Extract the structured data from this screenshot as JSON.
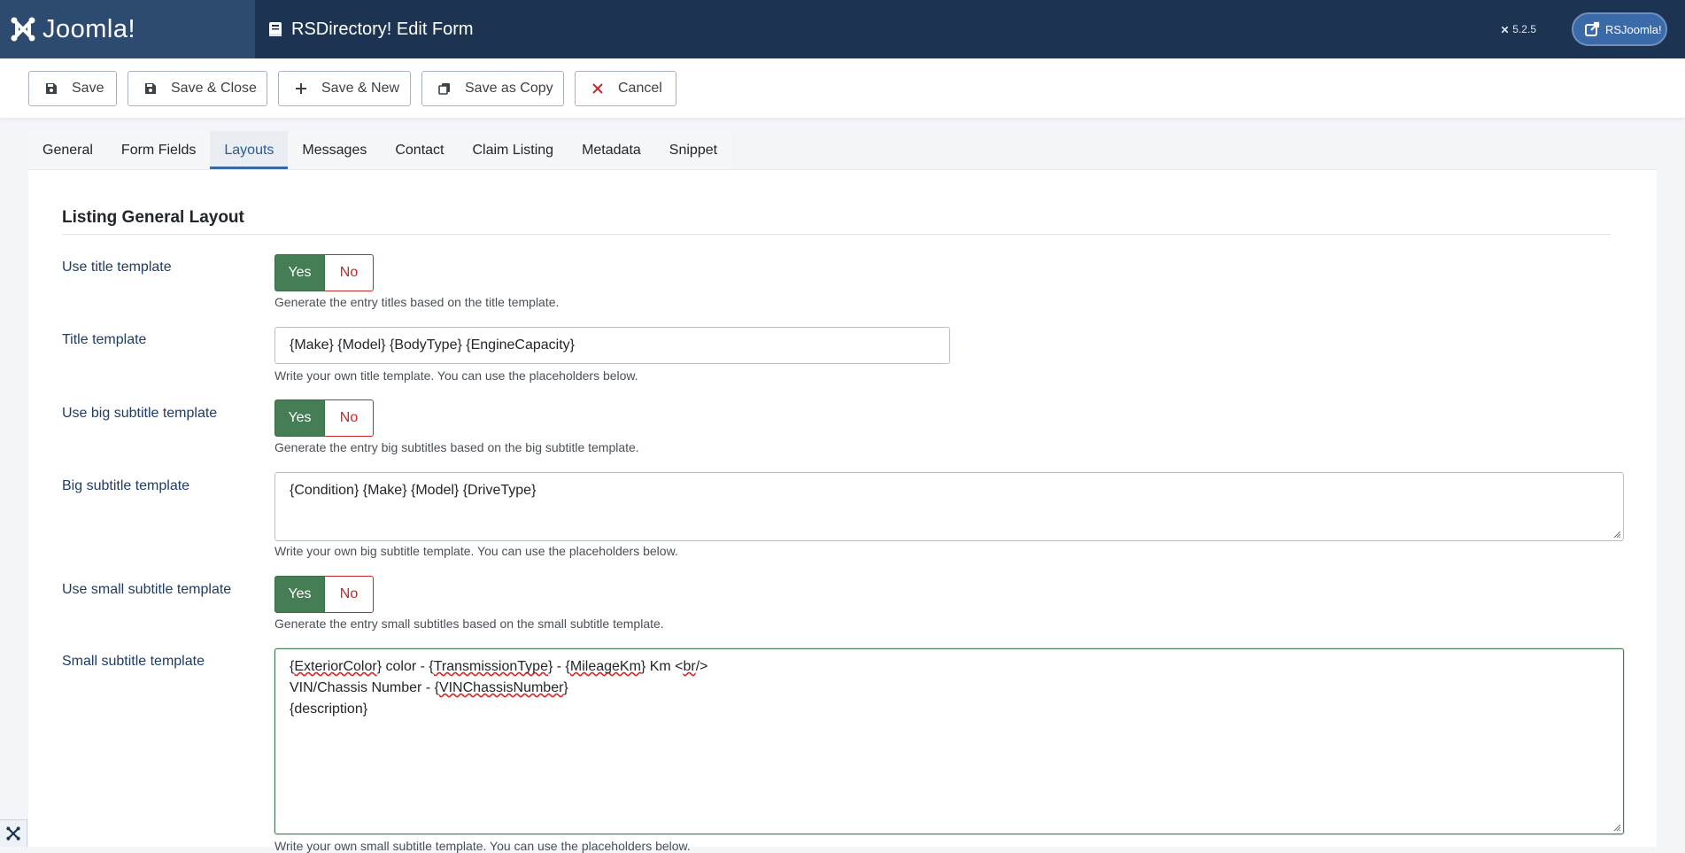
{
  "header": {
    "logo_text": "Joomla!",
    "page_title": "RSDirectory! Edit Form",
    "version": "5.2.5",
    "user_label": "RSJoomla!"
  },
  "toolbar": {
    "save": "Save",
    "save_close": "Save & Close",
    "save_new": "Save & New",
    "save_copy": "Save as Copy",
    "cancel": "Cancel"
  },
  "tabs": [
    "General",
    "Form Fields",
    "Layouts",
    "Messages",
    "Contact",
    "Claim Listing",
    "Metadata",
    "Snippet"
  ],
  "active_tab": "Layouts",
  "section": {
    "title": "Listing General Layout"
  },
  "fields": {
    "use_title": {
      "label": "Use title template",
      "yes": "Yes",
      "no": "No",
      "selected": "Yes",
      "desc": "Generate the entry titles based on the title template."
    },
    "title_template": {
      "label": "Title template",
      "value": "{Make} {Model} {BodyType} {EngineCapacity}",
      "desc": "Write your own title template. You can use the placeholders below."
    },
    "use_big_subtitle": {
      "label": "Use big subtitle template",
      "yes": "Yes",
      "no": "No",
      "selected": "Yes",
      "desc": "Generate the entry big subtitles based on the big subtitle template."
    },
    "big_subtitle_template": {
      "label": "Big subtitle template",
      "value": "{Condition} {Make} {Model} {DriveType}",
      "desc": "Write your own big subtitle template. You can use the placeholders below."
    },
    "use_small_subtitle": {
      "label": "Use small subtitle template",
      "yes": "Yes",
      "no": "No",
      "selected": "Yes",
      "desc": "Generate the entry small subtitles based on the small subtitle template."
    },
    "small_subtitle_template": {
      "label": "Small subtitle template",
      "line1_a": "{",
      "line1_b": "ExteriorColor",
      "line1_c": "} color - {",
      "line1_d": "TransmissionType",
      "line1_e": "} - {",
      "line1_f": "MileageKm",
      "line1_g": "} Km <",
      "line1_h": "br",
      "line1_i": "/>",
      "line2_a": "VIN/Chassis Number - {",
      "line2_b": "VINChassisNumber",
      "line2_c": "}",
      "line3": "{description}",
      "desc": "Write your own small subtitle template. You can use the placeholders below."
    }
  },
  "colors": {
    "header_bg": "#1c3452",
    "logo_bg": "#2d4b70",
    "yes_green": "#457d54",
    "no_red": "#c52827",
    "tab_active": "#2a5a98"
  }
}
